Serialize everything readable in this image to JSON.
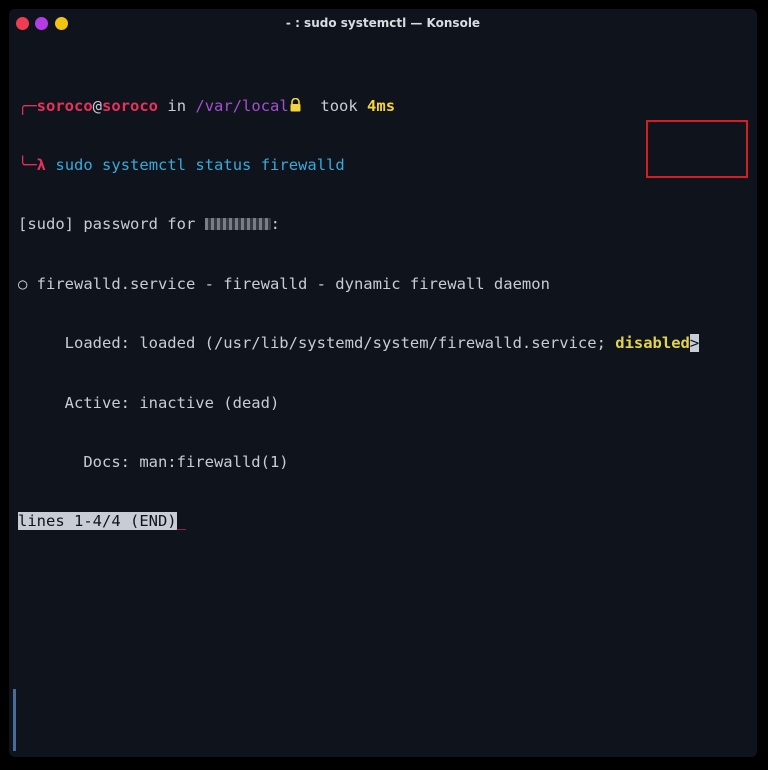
{
  "window": {
    "title": "- : sudo systemctl — Konsole"
  },
  "prompt": {
    "user": "soroco",
    "at": "@",
    "host": "soroco",
    "in": "in",
    "path": "/var/local",
    "lock_icon": "lock-icon",
    "took": "took",
    "duration": "4ms",
    "lambda": "λ",
    "command_sudo": "sudo",
    "command_systemctl": "systemctl",
    "command_status": "status",
    "command_service": "firewalld"
  },
  "output": {
    "sudo_prompt": "[sudo] password for ",
    "sudo_prompt_colon": ":",
    "service_line": "○ firewalld.service - firewalld - dynamic firewall daemon",
    "loaded_line": "     Loaded: loaded (/usr/lib/systemd/system/firewalld.service; ",
    "loaded_state": "disabled",
    "loaded_more": ">",
    "active_line": "     Active: inactive (dead)",
    "docs_line": "       Docs: man:firewalld(1)",
    "pager_status": "lines 1-4/4 (END)",
    "cursor": "_"
  },
  "colors": {
    "background": "#0f141c",
    "prompt_red": "#e8315a",
    "path_purple": "#a34fd1",
    "duration_yellow": "#f3d43e",
    "command_cyan": "#38a9d8",
    "highlight_box": "#d91c24"
  }
}
